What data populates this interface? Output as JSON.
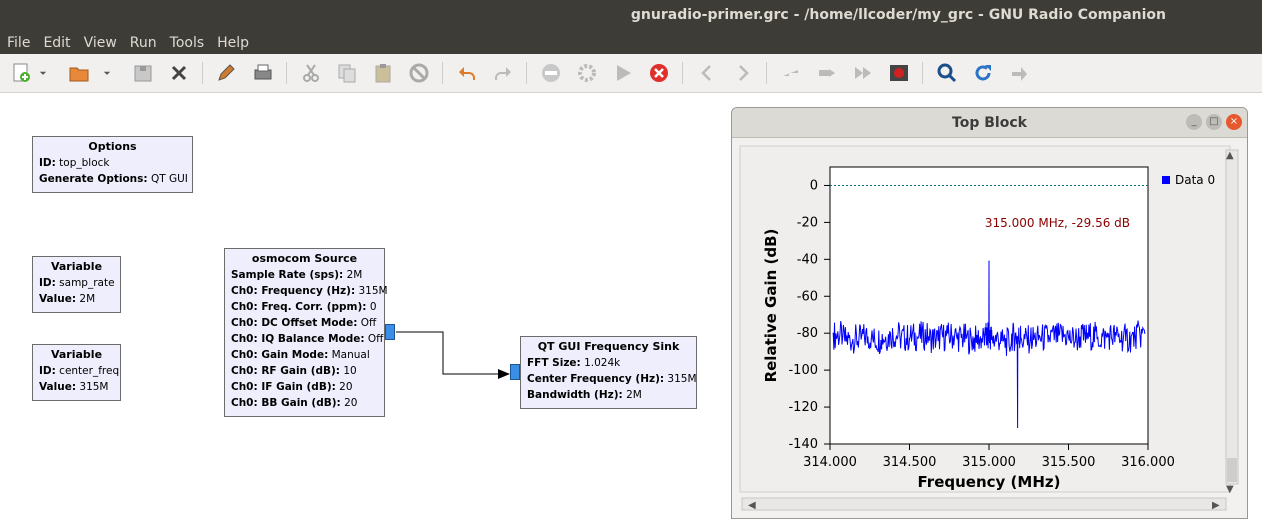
{
  "window": {
    "title": "gnuradio-primer.grc - /home/llcoder/my_grc - GNU Radio Companion"
  },
  "menu": [
    "File",
    "Edit",
    "View",
    "Run",
    "Tools",
    "Help"
  ],
  "toolbar": {
    "icons": [
      "new-icon",
      "new-dropdown-icon",
      "open-icon",
      "open-dropdown-icon",
      "save-icon",
      "close-icon",
      "edit-icon",
      "print-icon",
      "cut-icon",
      "copy-icon",
      "paste-icon",
      "disable-icon",
      "undo-icon",
      "redo-icon",
      "error-icon",
      "generate-icon",
      "execute-icon",
      "kill-icon",
      "left-icon",
      "right-icon",
      "rotate-ccw-icon",
      "rotate-cw-icon",
      "forward-icon",
      "stop-icon",
      "find-icon",
      "reload-icon",
      "bypass-icon"
    ]
  },
  "blocks": {
    "options": {
      "title": "Options",
      "rows": [
        {
          "k": "ID:",
          "v": " top_block"
        },
        {
          "k": "Generate Options:",
          "v": " QT GUI"
        }
      ]
    },
    "var_samp": {
      "title": "Variable",
      "rows": [
        {
          "k": "ID:",
          "v": " samp_rate"
        },
        {
          "k": "Value:",
          "v": " 2M"
        }
      ]
    },
    "var_center": {
      "title": "Variable",
      "rows": [
        {
          "k": "ID:",
          "v": " center_freq"
        },
        {
          "k": "Value:",
          "v": " 315M"
        }
      ]
    },
    "osmocom": {
      "title": "osmocom Source",
      "rows": [
        {
          "k": "Sample Rate (sps):",
          "v": " 2M"
        },
        {
          "k": "Ch0: Frequency (Hz):",
          "v": " 315M"
        },
        {
          "k": "Ch0: Freq. Corr. (ppm):",
          "v": " 0"
        },
        {
          "k": "Ch0: DC Offset Mode:",
          "v": " Off"
        },
        {
          "k": "Ch0: IQ Balance Mode:",
          "v": " Off"
        },
        {
          "k": "Ch0: Gain Mode:",
          "v": " Manual"
        },
        {
          "k": "Ch0: RF Gain (dB):",
          "v": " 10"
        },
        {
          "k": "Ch0: IF Gain (dB):",
          "v": " 20"
        },
        {
          "k": "Ch0: BB Gain (dB):",
          "v": " 20"
        }
      ]
    },
    "sink": {
      "title": "QT GUI Frequency Sink",
      "rows": [
        {
          "k": "FFT Size:",
          "v": " 1.024k"
        },
        {
          "k": "Center Frequency (Hz):",
          "v": " 315M"
        },
        {
          "k": "Bandwidth (Hz):",
          "v": " 2M"
        }
      ]
    }
  },
  "qt_window": {
    "title": "Top Block",
    "buttons": [
      "_",
      "□",
      "×"
    ]
  },
  "chart_data": {
    "type": "line",
    "xlabel": "Frequency (MHz)",
    "ylabel": "Relative Gain (dB)",
    "xlim": [
      314.0,
      316.0
    ],
    "ylim": [
      -140,
      10
    ],
    "xticks": [
      "314.000",
      "314.500",
      "315.000",
      "315.500",
      "316.000"
    ],
    "yticks": [
      "0",
      "-20",
      "-40",
      "-60",
      "-80",
      "-100",
      "-120",
      "-140"
    ],
    "marker_text": "315.000 MHz, -29.56 dB",
    "reference_line_db": 0,
    "legend": {
      "placement": "top-right",
      "entries": [
        "Data 0"
      ]
    },
    "series": [
      {
        "name": "Data 0",
        "color": "#0000ff",
        "x": [
          314.02,
          314.08,
          314.14,
          314.2,
          314.26,
          314.32,
          314.38,
          314.44,
          314.5,
          314.56,
          314.62,
          314.68,
          314.74,
          314.8,
          314.86,
          314.92,
          314.98,
          315.0,
          315.02,
          315.08,
          315.14,
          315.18,
          315.2,
          315.26,
          315.32,
          315.38,
          315.44,
          315.5,
          315.56,
          315.62,
          315.68,
          315.74,
          315.8,
          315.86,
          315.92,
          315.98
        ],
        "y": [
          -80,
          -82,
          -85,
          -81,
          -83,
          -84,
          -80,
          -82,
          -83,
          -81,
          -82,
          -84,
          -80,
          -83,
          -82,
          -85,
          -81,
          -41,
          -82,
          -84,
          -86,
          -131,
          -83,
          -84,
          -82,
          -83,
          -81,
          -82,
          -84,
          -80,
          -83,
          -82,
          -81,
          -84,
          -82,
          -80
        ]
      }
    ]
  },
  "colors": {
    "canvas": "#ffffff",
    "block_bg": "#eeeefc",
    "port": "#3b8ee6",
    "trace": "#0000ff",
    "marker_text": "#8b0000"
  }
}
